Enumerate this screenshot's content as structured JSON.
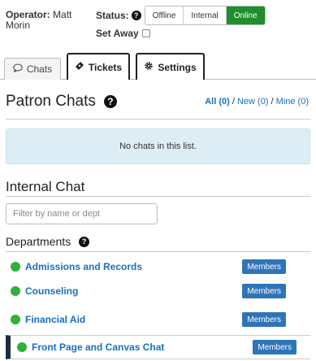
{
  "operator": {
    "label": "Operator:",
    "name": "Matt Morin"
  },
  "status": {
    "label": "Status:",
    "options": [
      "Offline",
      "Internal",
      "Online"
    ],
    "active": "Online",
    "away_label": "Set Away"
  },
  "tabs": [
    {
      "label": "Chats",
      "icon": "chat-bubble-icon"
    },
    {
      "label": "Tickets",
      "icon": "ticket-icon"
    },
    {
      "label": "Settings",
      "icon": "gear-icon"
    }
  ],
  "patron": {
    "title": "Patron Chats",
    "filters": {
      "all": "All (0)",
      "sep1": " / ",
      "new": "New (0)",
      "sep2": " / ",
      "mine": "Mine (0)"
    },
    "empty_message": "No chats in this list."
  },
  "internal": {
    "title": "Internal Chat",
    "filter_placeholder": "Filter by name or dept",
    "departments_title": "Departments",
    "departments": [
      {
        "name": "Admissions and Records",
        "button": "Members"
      },
      {
        "name": "Counseling",
        "button": "Members"
      },
      {
        "name": "Financial Aid",
        "button": "Members"
      },
      {
        "name": "Front Page and Canvas Chat",
        "button": "Members"
      }
    ]
  },
  "colors": {
    "online_green": "#1e8f2c",
    "link_blue": "#1a6ec2",
    "button_blue": "#2f74b8",
    "status_dot": "#2db33a"
  }
}
